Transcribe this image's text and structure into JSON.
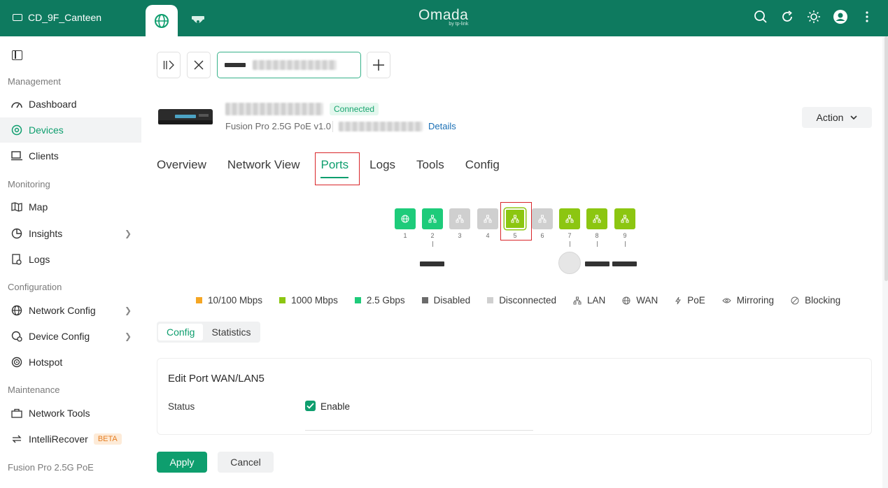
{
  "header": {
    "site_name": "CD_9F_Canteen",
    "logo_text": "Omada",
    "logo_sub": "by tp-link"
  },
  "sidebar": {
    "sections": [
      {
        "title": "Management",
        "items": [
          {
            "label": "Dashboard",
            "icon": "dashboard-icon"
          },
          {
            "label": "Devices",
            "icon": "devices-icon",
            "active": true
          },
          {
            "label": "Clients",
            "icon": "clients-icon"
          }
        ]
      },
      {
        "title": "Monitoring",
        "items": [
          {
            "label": "Map",
            "icon": "map-icon"
          },
          {
            "label": "Insights",
            "icon": "insights-icon"
          },
          {
            "label": "Logs",
            "icon": "logs-icon"
          }
        ]
      },
      {
        "title": "Configuration",
        "items": [
          {
            "label": "Network Config",
            "icon": "globe-icon"
          },
          {
            "label": "Device Config",
            "icon": "device-config-icon"
          },
          {
            "label": "Hotspot",
            "icon": "hotspot-icon"
          }
        ]
      },
      {
        "title": "Maintenance",
        "items": [
          {
            "label": "Network Tools",
            "icon": "toolbox-icon"
          },
          {
            "label": "IntelliRecover",
            "icon": "recover-icon",
            "badge": "BETA"
          }
        ]
      },
      {
        "title": "Fusion Pro 2.5G PoE",
        "items": []
      }
    ]
  },
  "device": {
    "status": "Connected",
    "model": "Fusion Pro 2.5G PoE v1.0",
    "details_link": "Details",
    "action_label": "Action"
  },
  "tabs": [
    "Overview",
    "Network View",
    "Ports",
    "Logs",
    "Tools",
    "Config"
  ],
  "active_tab": "Ports",
  "ports": [
    {
      "num": "1",
      "type": "wan",
      "color": "#1ecb7a"
    },
    {
      "num": "2",
      "type": "lan",
      "color": "#1ecb7a"
    },
    {
      "num": "3",
      "type": "lan",
      "color": "#cfcfcf"
    },
    {
      "num": "4",
      "type": "lan",
      "color": "#cfcfcf"
    },
    {
      "num": "5",
      "type": "lan",
      "color": "#8cc611",
      "selected": true
    },
    {
      "num": "6",
      "type": "lan",
      "color": "#cfcfcf"
    },
    {
      "num": "7",
      "type": "lan",
      "color": "#8cc611"
    },
    {
      "num": "8",
      "type": "lan",
      "color": "#8cc611"
    },
    {
      "num": "9",
      "type": "lan",
      "color": "#8cc611"
    }
  ],
  "legend": [
    {
      "label": "10/100 Mbps",
      "color": "#f5a623"
    },
    {
      "label": "1000 Mbps",
      "color": "#8cc611"
    },
    {
      "label": "2.5 Gbps",
      "color": "#1ecb7a"
    },
    {
      "label": "Disabled",
      "color": "#6b6b6b"
    },
    {
      "label": "Disconnected",
      "color": "#cfcfcf"
    },
    {
      "label": "LAN",
      "glyph": "lan-icon"
    },
    {
      "label": "WAN",
      "glyph": "wan-icon"
    },
    {
      "label": "PoE",
      "glyph": "poe-icon"
    },
    {
      "label": "Mirroring",
      "glyph": "mirroring-icon"
    },
    {
      "label": "Blocking",
      "glyph": "blocking-icon"
    }
  ],
  "subtabs": [
    "Config",
    "Statistics"
  ],
  "panel": {
    "title": "Edit Port WAN/LAN5",
    "status_label": "Status",
    "enable_label": "Enable"
  },
  "buttons": {
    "apply": "Apply",
    "cancel": "Cancel"
  }
}
